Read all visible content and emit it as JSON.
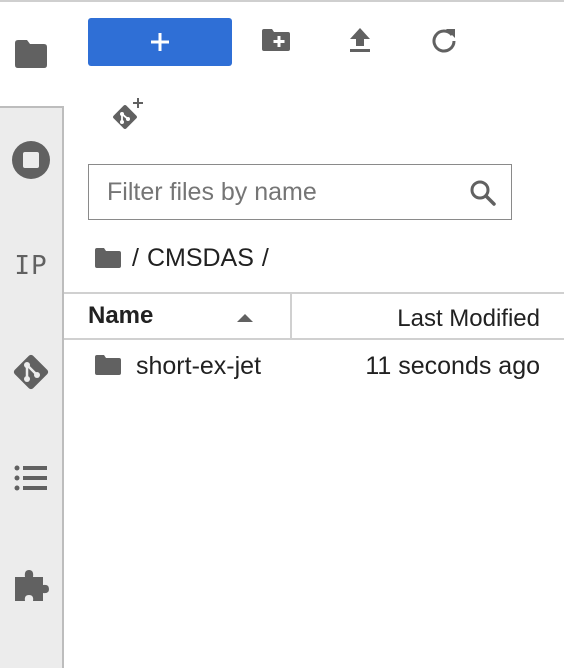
{
  "toolbar": {
    "new_label": "+",
    "new_folder_icon": "new-folder-icon",
    "upload_icon": "upload-icon",
    "refresh_icon": "refresh-icon",
    "git_clone_icon": "git-clone-icon",
    "accent_color": "#2f6fd6"
  },
  "sidebar": {
    "items": [
      {
        "name": "file-browser",
        "icon": "folder-icon"
      },
      {
        "name": "running",
        "icon": "stop-circle-icon"
      },
      {
        "name": "ipython",
        "icon": "ip-icon",
        "label": "IP"
      },
      {
        "name": "git",
        "icon": "git-icon"
      },
      {
        "name": "table-of-contents",
        "icon": "list-icon"
      },
      {
        "name": "extensions",
        "icon": "puzzle-icon"
      }
    ]
  },
  "filter": {
    "placeholder": "Filter files by name",
    "value": ""
  },
  "breadcrumb": {
    "root_sep": "/",
    "segment": "CMSDAS",
    "trailing_sep": "/"
  },
  "listing": {
    "columns": {
      "name": "Name",
      "modified": "Last Modified"
    },
    "sort": "ascending",
    "rows": [
      {
        "name": "short-ex-jet",
        "type": "folder",
        "modified": "11 seconds ago"
      }
    ]
  }
}
